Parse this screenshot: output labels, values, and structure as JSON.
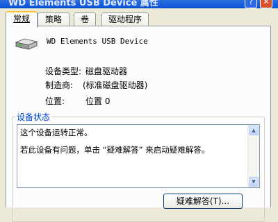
{
  "window": {
    "title": "WD Elements USB Device 属性",
    "help_label": "?",
    "close_label": "✕"
  },
  "tabs": [
    {
      "label": "常规",
      "active": true
    },
    {
      "label": "策略",
      "active": false
    },
    {
      "label": "卷",
      "active": false
    },
    {
      "label": "驱动程序",
      "active": false
    }
  ],
  "device": {
    "icon": "disk-drive-icon",
    "name": "WD Elements USB Device"
  },
  "properties": [
    {
      "label": "设备类型:",
      "value": "磁盘驱动器"
    },
    {
      "label": "制造商:",
      "value": "(标准磁盘驱动器)"
    },
    {
      "label": "位置:",
      "value": "位置 0"
    }
  ],
  "status": {
    "group_label": "设备状态",
    "lines": [
      "这个设备运转正常。",
      "若此设备有问题，单击 “疑难解答” 来启动疑难解答。"
    ]
  },
  "buttons": {
    "troubleshoot": "疑难解答(T)..."
  },
  "colors": {
    "title_bar": "#0a4fd6",
    "group_label": "#0046d5",
    "tab_highlight": "#ffc83c",
    "dialog_bg": "#ece9d8",
    "panel_bg": "#fcfcfe"
  }
}
